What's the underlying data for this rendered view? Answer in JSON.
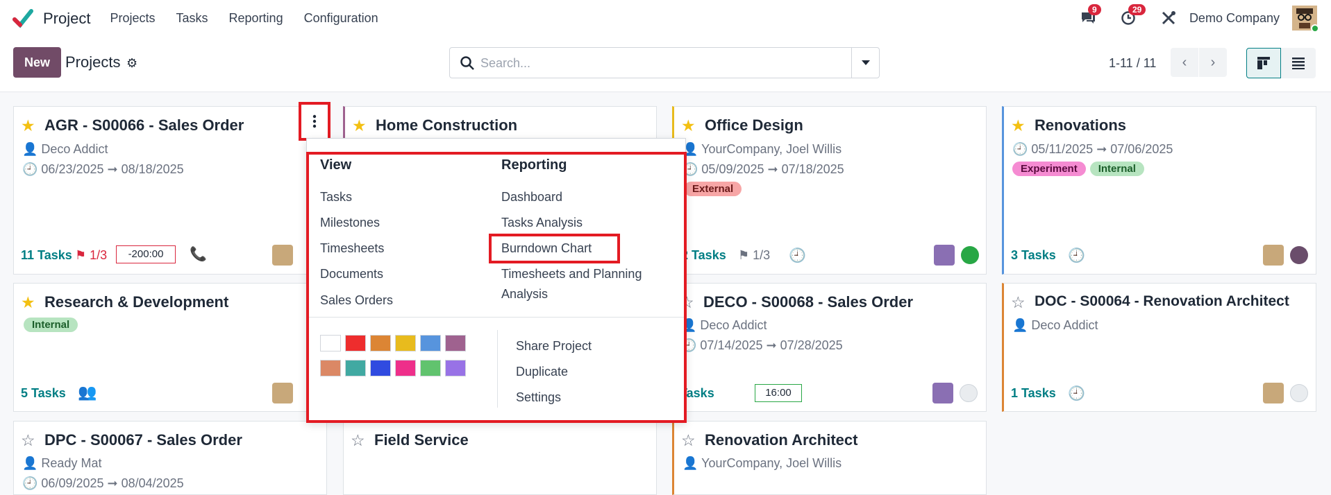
{
  "app": {
    "name": "Project"
  },
  "menu": [
    "Projects",
    "Tasks",
    "Reporting",
    "Configuration"
  ],
  "topbar": {
    "messages_count": "9",
    "activities_count": "29",
    "company": "Demo Company"
  },
  "control": {
    "new_label": "New",
    "breadcrumb": "Projects",
    "search_placeholder": "Search...",
    "pager": "1-11 / 11"
  },
  "cards": {
    "agr": {
      "title": "AGR - S00066 - Sales Order",
      "customer": "Deco Addict",
      "start": "06/23/2025",
      "end": "08/18/2025",
      "tasks": "11 Tasks",
      "milestones": "1/3",
      "hours": "-200:00"
    },
    "home": {
      "title": "Home Construction"
    },
    "office": {
      "title": "Office Design",
      "customer": "YourCompany, Joel Willis",
      "start": "05/09/2025",
      "end": "07/18/2025",
      "tag": "External",
      "tasks": "2 Tasks",
      "milestones": "1/3"
    },
    "renov": {
      "title": "Renovations",
      "start": "05/11/2025",
      "end": "07/06/2025",
      "tags": [
        "Experiment",
        "Internal"
      ],
      "tasks": "3 Tasks"
    },
    "rnd": {
      "title": "Research & Development",
      "tag": "Internal",
      "tasks": "5 Tasks"
    },
    "deco": {
      "title": "DECO - S00068 - Sales Order",
      "customer": "Deco Addict",
      "start": "07/14/2025",
      "end": "07/28/2025",
      "tasks": "Tasks",
      "hours": "16:00"
    },
    "doc": {
      "title": "DOC - S00064 - Renovation Architect",
      "customer": "Deco Addict",
      "tasks": "1 Tasks"
    },
    "dpc": {
      "title": "DPC - S00067 - Sales Order",
      "customer": "Ready Mat",
      "start": "06/09/2025",
      "end": "08/04/2025"
    },
    "field": {
      "title": "Field Service"
    },
    "arch": {
      "title": "Renovation Architect",
      "customer": "YourCompany, Joel Willis"
    }
  },
  "dropdown": {
    "view_header": "View",
    "view_items": [
      "Tasks",
      "Milestones",
      "Timesheets",
      "Documents",
      "Sales Orders"
    ],
    "reporting_header": "Reporting",
    "reporting_items": [
      "Dashboard",
      "Tasks Analysis",
      "Burndown Chart",
      "Timesheets and Planning",
      "Analysis"
    ],
    "actions": [
      "Share Project",
      "Duplicate",
      "Settings"
    ],
    "colors": [
      "#ffffff",
      "#ee2d2d",
      "#dc8534",
      "#e8bb1d",
      "#5794dd",
      "#9f628f",
      "#db8865",
      "#41a9a2",
      "#304be0",
      "#ee2f8a",
      "#61c36e",
      "#9872e6"
    ]
  }
}
